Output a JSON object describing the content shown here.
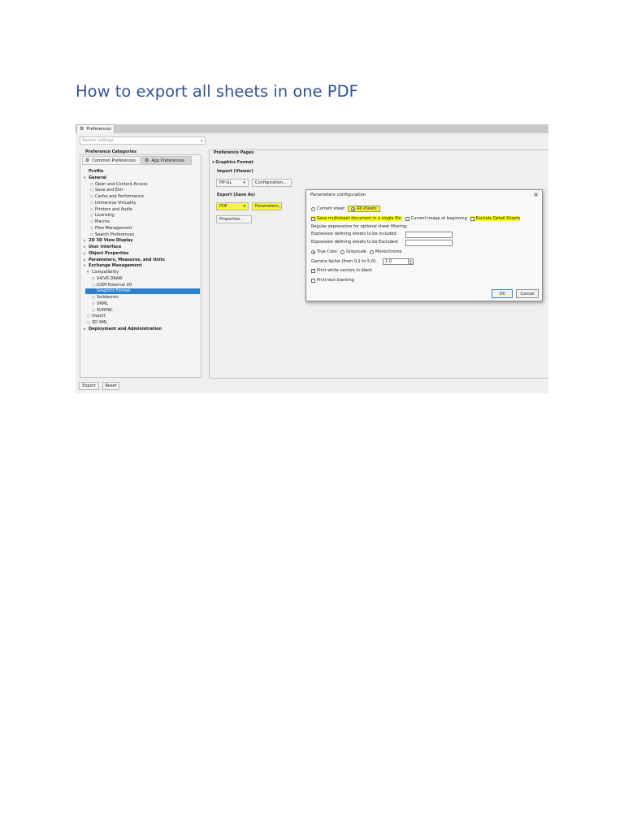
{
  "document": {
    "title": "How to export all sheets in one PDF"
  },
  "preferences_window": {
    "tab_label": "Preferences",
    "search_placeholder": "Search settings",
    "categories_label": "Preference Categories",
    "subtabs": [
      "Common Preferences",
      "App Preferences"
    ],
    "tree": [
      {
        "label": "Profile",
        "bold": true,
        "mark": ""
      },
      {
        "label": "General",
        "bold": true,
        "mark": "▾"
      },
      {
        "label": "Open and Content Access",
        "bold": false,
        "mark": "○"
      },
      {
        "label": "Save and Exit",
        "bold": false,
        "mark": "○"
      },
      {
        "label": "Cache and Performance",
        "bold": false,
        "mark": "○"
      },
      {
        "label": "Immersive Virtuality",
        "bold": false,
        "mark": "○"
      },
      {
        "label": "Printers and Audio",
        "bold": false,
        "mark": "○"
      },
      {
        "label": "Licensing",
        "bold": false,
        "mark": "○"
      },
      {
        "label": "Macros",
        "bold": false,
        "mark": "○"
      },
      {
        "label": "Files Management",
        "bold": false,
        "mark": "○"
      },
      {
        "label": "Search Preferences",
        "bold": false,
        "mark": "○"
      },
      {
        "label": "2D 3D View Display",
        "bold": true,
        "mark": "▸"
      },
      {
        "label": "User Interface",
        "bold": true,
        "mark": "▸"
      },
      {
        "label": "Object Properties",
        "bold": true,
        "mark": "▸"
      },
      {
        "label": "Parameters, Measures, and Units",
        "bold": true,
        "mark": "▸"
      },
      {
        "label": "Exchange Management",
        "bold": true,
        "mark": "▾"
      },
      {
        "label": "Compatibility",
        "bold": false,
        "mark": "▾"
      },
      {
        "label": "V4/V6 DRAW",
        "bold": false,
        "mark": "○"
      },
      {
        "label": "ICEM External I/O",
        "bold": false,
        "mark": "○"
      },
      {
        "label": "Graphics Format",
        "bold": false,
        "mark": "○",
        "selected": true
      },
      {
        "label": "Solidworks",
        "bold": false,
        "mark": "○"
      },
      {
        "label": "VRML",
        "bold": false,
        "mark": "○"
      },
      {
        "label": "SURPRC",
        "bold": false,
        "mark": "○"
      },
      {
        "label": "Import",
        "bold": false,
        "mark": "○"
      },
      {
        "label": "3D XML",
        "bold": false,
        "mark": "○"
      },
      {
        "label": "Deployment and Administration",
        "bold": true,
        "mark": "▸"
      }
    ],
    "buttons": {
      "export": "Export",
      "reset": "Reset"
    },
    "pages": {
      "label": "Preference Pages",
      "section": "Graphics Format",
      "import_label": "Import (Viewer)",
      "import_format": "HP-GL",
      "configuration_button": "Configuration...",
      "export_label": "Export (Save As)",
      "export_format": "PDF",
      "parameters_button": "Parameters...",
      "properties_button": "Properties..."
    }
  },
  "dialog": {
    "title": "Parameters configuration",
    "current_sheet": "Current sheet",
    "all_sheets": "All sheets",
    "save_multisheet": "Save multisheet document in a single file",
    "current_image": "Current image at beginning",
    "exclude_detail": "Exclude Detail Sheets",
    "regex_label": "Regular expressions for optional sheet filtering:",
    "include_label": "Expression defining sheets to be included:",
    "exclude_label": "Expression defining sheets to be Excluded:",
    "true_color": "True Color",
    "greyscale": "Greyscale",
    "monochrome": "Monochrome",
    "gamma_label": "Gamma factor (from 0.1 to 5.0):",
    "gamma_value": "1.0",
    "print_white": "Print white vectors in black",
    "print_text": "Print text blanking",
    "ok": "OK",
    "cancel": "Cancel"
  },
  "colors": {
    "title": "#2f5597",
    "highlight": "#f6f536",
    "selection": "#2d7fd0"
  }
}
